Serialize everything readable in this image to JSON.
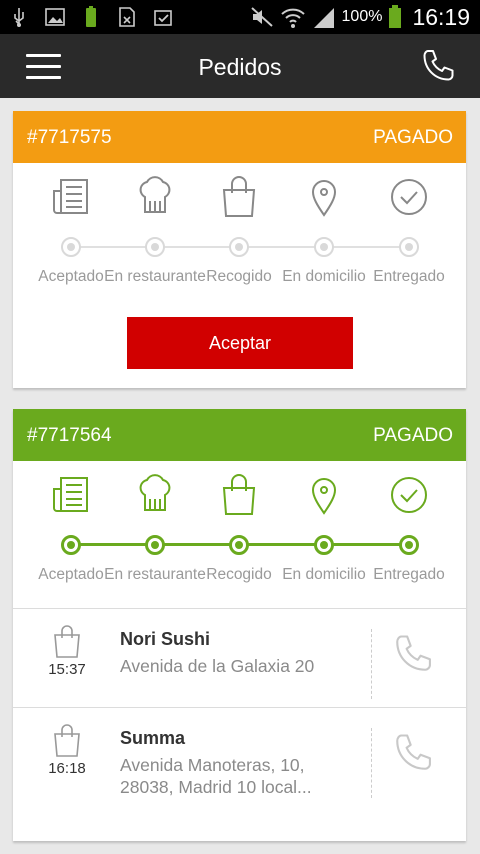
{
  "status_bar": {
    "battery_percent": "100%",
    "time": "16:19",
    "icons": [
      "usb-icon",
      "image-icon",
      "battery-full-icon",
      "sim-icon",
      "clipboard-check-icon",
      "mute-icon",
      "wifi-icon",
      "signal-icon",
      "battery-icon"
    ]
  },
  "toolbar": {
    "title": "Pedidos",
    "menu_icon": "hamburger-icon",
    "call_icon": "phone-icon"
  },
  "steps": [
    "Aceptado",
    "En restaurante",
    "Recogido",
    "En domicilio",
    "Entregado"
  ],
  "orders": [
    {
      "id": "#7717575",
      "status": "PAGADO",
      "color": "#f39c12",
      "progress_completed_steps": 0,
      "action_label": "Aceptar"
    },
    {
      "id": "#7717564",
      "status": "PAGADO",
      "color": "#6aaa1e",
      "progress_completed_steps": 5,
      "deliveries": [
        {
          "time": "15:37",
          "name": "Nori Sushi",
          "address": "Avenida de la Galaxia 20"
        },
        {
          "time": "16:18",
          "name": "Summa",
          "address": "Avenida Manoteras, 10, 28038, Madrid 10 local..."
        }
      ]
    }
  ],
  "colors": {
    "toolbar": "#2a2a2a",
    "accept_button": "#d10000",
    "inactive_step": "#888888",
    "active_step": "#6aaa1e"
  }
}
